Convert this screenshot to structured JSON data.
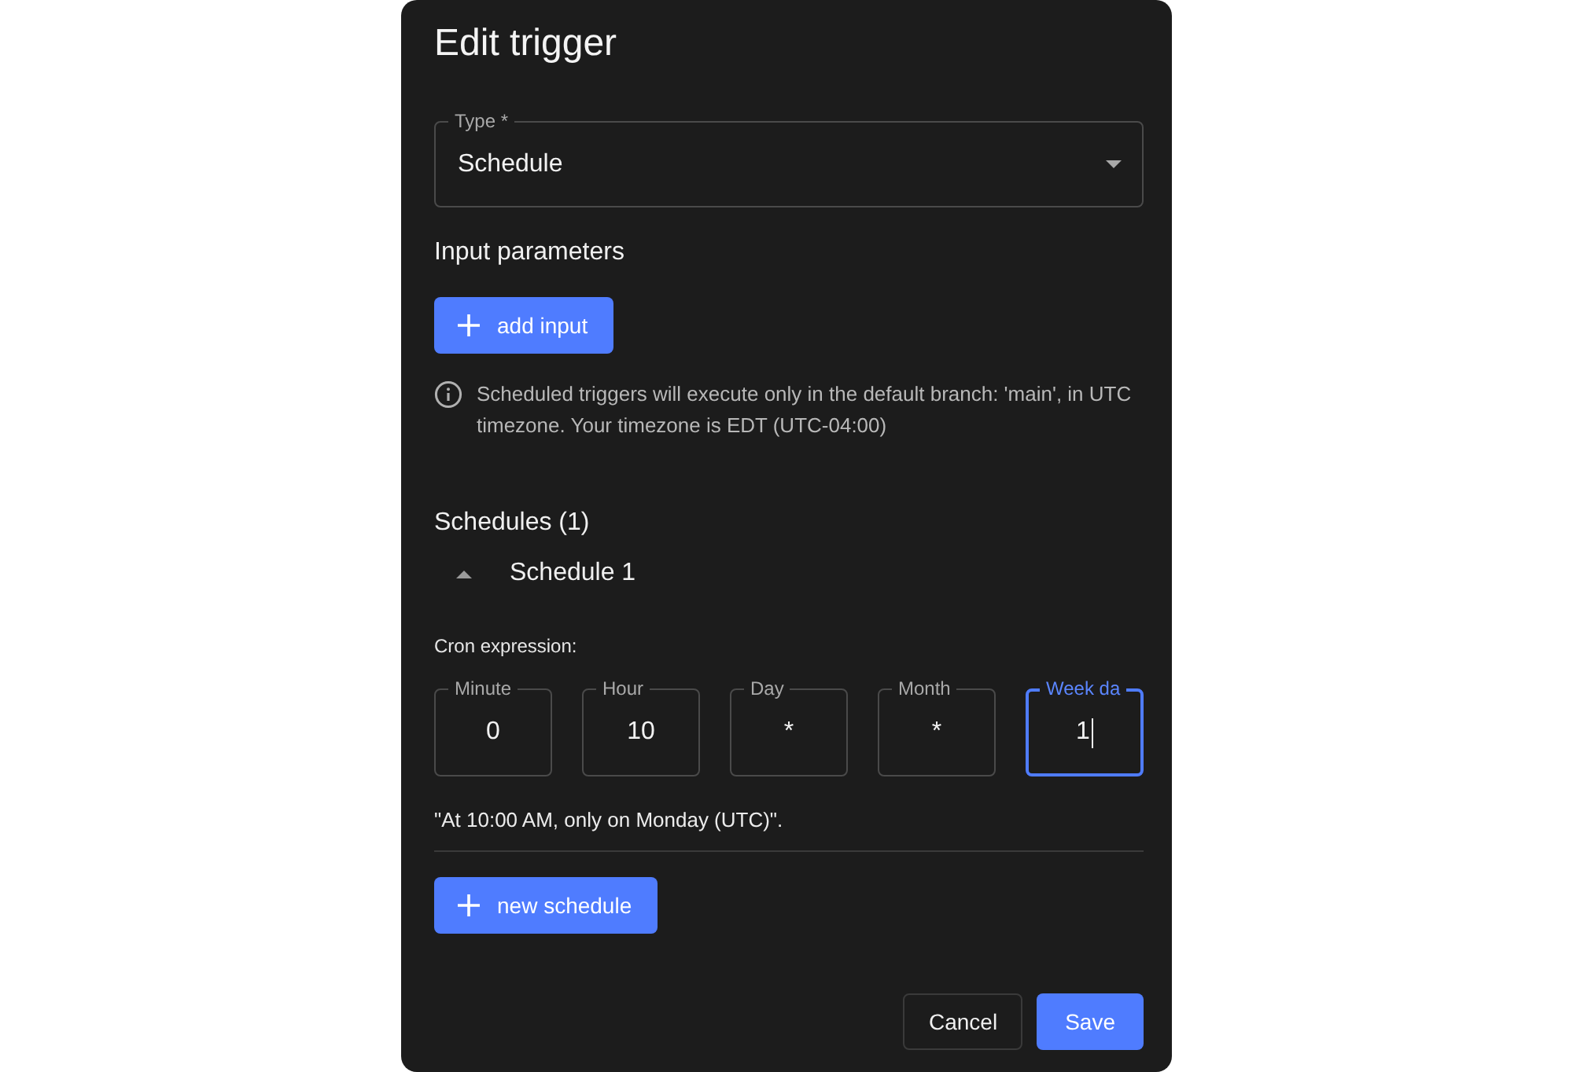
{
  "dialog": {
    "title": "Edit trigger"
  },
  "type_field": {
    "label": "Type *",
    "value": "Schedule"
  },
  "input_parameters": {
    "heading": "Input parameters",
    "add_button": "add input",
    "info": "Scheduled triggers will execute only in the default branch: 'main', in UTC timezone. Your timezone is EDT (UTC-04:00)"
  },
  "schedules": {
    "heading": "Schedules (1)",
    "items": [
      {
        "title": "Schedule 1",
        "expanded": true,
        "cron_label": "Cron expression:",
        "fields": [
          {
            "label": "Minute",
            "value": "0",
            "focused": false
          },
          {
            "label": "Hour",
            "value": "10",
            "focused": false
          },
          {
            "label": "Day",
            "value": "*",
            "focused": false
          },
          {
            "label": "Month",
            "value": "*",
            "focused": false
          },
          {
            "label": "Week da",
            "value": "1",
            "focused": true
          }
        ],
        "description": "\"At 10:00 AM, only on Monday (UTC)\"."
      }
    ],
    "add_button": "new schedule"
  },
  "buttons": [
    {
      "label": "Cancel",
      "kind": "secondary"
    },
    {
      "label": "Save",
      "kind": "primary"
    }
  ]
}
